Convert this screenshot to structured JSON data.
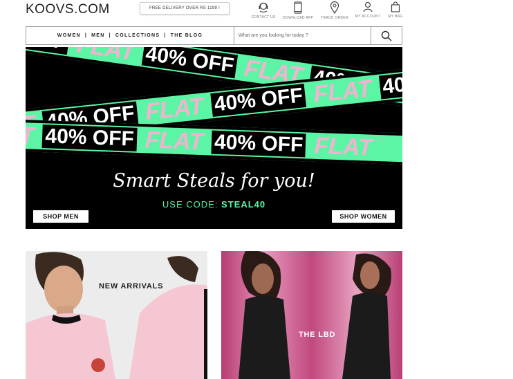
{
  "header": {
    "logo": "KOOVS.COM",
    "promo": "FREE DELIVERY OVER RS 1199 !",
    "utilities": [
      {
        "label": "CONTACT US",
        "icon": "headset-icon"
      },
      {
        "label": "DOWNLOAD APP",
        "icon": "phone-icon"
      },
      {
        "label": "TRACK ORDER",
        "icon": "location-pin-icon"
      },
      {
        "label": "MY ACCOUNT",
        "icon": "user-icon"
      },
      {
        "label": "MY BAG",
        "icon": "bag-icon"
      }
    ]
  },
  "nav": {
    "items": [
      "WOMEN",
      "MEN",
      "COLLECTIONS",
      "THE BLOG"
    ],
    "separator": "|",
    "search_placeholder": "What are you looking for today ?"
  },
  "hero": {
    "flat": "FLAT",
    "off": "40% OFF",
    "slogan": "Smart Steals for you!",
    "code_prefix": "USE CODE:",
    "code": "STEAL40",
    "shop_men": "SHOP MEN",
    "shop_women": "SHOP WOMEN",
    "colors": {
      "accent": "#5cf5a5",
      "pink": "#f2b3d1",
      "background": "#000000"
    }
  },
  "tiles": {
    "new_arrivals": "NEW ARRIVALS",
    "lbd": "THE LBD"
  }
}
